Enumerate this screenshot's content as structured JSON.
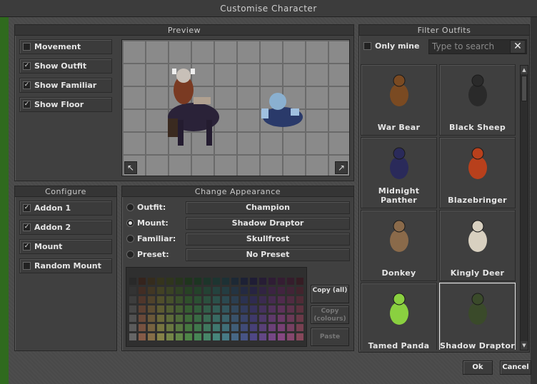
{
  "window": {
    "title": "Customise Character"
  },
  "preview": {
    "header": "Preview",
    "options": [
      {
        "label": "Movement",
        "checked": false
      },
      {
        "label": "Show Outfit",
        "checked": true
      },
      {
        "label": "Show Familiar",
        "checked": true
      },
      {
        "label": "Show Floor",
        "checked": true
      }
    ]
  },
  "configure": {
    "header": "Configure",
    "options": [
      {
        "label": "Addon 1",
        "checked": true
      },
      {
        "label": "Addon 2",
        "checked": true
      },
      {
        "label": "Mount",
        "checked": true
      },
      {
        "label": "Random Mount",
        "checked": false
      }
    ]
  },
  "appearance": {
    "header": "Change Appearance",
    "rows": [
      {
        "label": "Outfit:",
        "value": "Champion",
        "selected": false
      },
      {
        "label": "Mount:",
        "value": "Shadow Draptor",
        "selected": true
      },
      {
        "label": "Familiar:",
        "value": "Skullfrost",
        "selected": false
      },
      {
        "label": "Preset:",
        "value": "No Preset",
        "selected": false
      }
    ],
    "copy_all": "Copy (all)",
    "copy_colours": "Copy (colours)",
    "paste": "Paste"
  },
  "filter": {
    "header": "Filter Outfits",
    "only_mine": "Only mine",
    "only_mine_checked": false,
    "search_placeholder": "Type to search"
  },
  "outfits": [
    {
      "name": "War Bear",
      "selected": false,
      "color": "#7a4a22"
    },
    {
      "name": "Black Sheep",
      "selected": false,
      "color": "#2a2a2a"
    },
    {
      "name": "Midnight Panther",
      "selected": false,
      "color": "#2a2a5a"
    },
    {
      "name": "Blazebringer",
      "selected": false,
      "color": "#b8401c"
    },
    {
      "name": "Donkey",
      "selected": false,
      "color": "#8a6a4a"
    },
    {
      "name": "Kingly Deer",
      "selected": false,
      "color": "#d8d0c0"
    },
    {
      "name": "Tamed Panda",
      "selected": false,
      "color": "#8ad040"
    },
    {
      "name": "Shadow Draptor",
      "selected": true,
      "color": "#3a4a2a"
    }
  ],
  "buttons": {
    "ok": "Ok",
    "cancel": "Cancel"
  }
}
